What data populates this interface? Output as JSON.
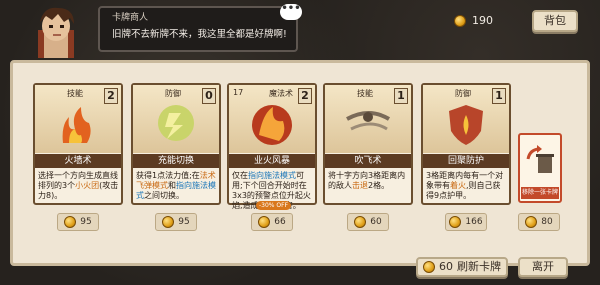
{
  "dialog": {
    "speaker": "卡牌商人",
    "text": "旧牌不去新牌不来，我这里全都是好牌啊!",
    "more_icon": "ellipsis-icon"
  },
  "currency": {
    "amount": "190",
    "icon": "coin-icon"
  },
  "buttons": {
    "bag": "背包",
    "refresh": "刷新卡牌",
    "refresh_cost": "60",
    "leave": "离开"
  },
  "cards": [
    {
      "type": "技能",
      "cost": "2",
      "name": "火墙术",
      "desc_parts": [
        "选择一个方向生成直线排列的3个",
        "小火团",
        "(攻击力8)。"
      ],
      "price": "95",
      "art": "fire-wall-icon"
    },
    {
      "type": "防御",
      "cost": "0",
      "name": "充能切换",
      "desc_parts": [
        "获得1点法力值;在",
        "法术飞弹模式",
        "和",
        "指向施法模式",
        "之间切换。"
      ],
      "price": "95",
      "art": "energy-switch-icon"
    },
    {
      "type": "魔法术",
      "level": "17",
      "cost": "2",
      "name": "业火风暴",
      "desc_parts": [
        "仅在",
        "指向施法模式",
        "可用;下个回合开始时在3x3的预警点位升起火焰,造成17点伤害。"
      ],
      "price": "66",
      "discount": "-30% OFF",
      "art": "fire-storm-icon"
    },
    {
      "type": "技能",
      "cost": "1",
      "name": "吹飞术",
      "desc_parts": [
        "将十字方向3格距离内的敌人",
        "击退",
        "2格。"
      ],
      "price": "60",
      "art": "blow-away-icon"
    },
    {
      "type": "防御",
      "cost": "1",
      "name": "回聚防护",
      "desc_parts": [
        "3格距离内每有一个对象带有",
        "着火",
        ",则自己获得9点护甲。"
      ],
      "price": "166",
      "art": "shield-fire-icon"
    }
  ],
  "special": {
    "label": "移除一张卡牌",
    "price": "80",
    "art": "trash-card-icon"
  }
}
